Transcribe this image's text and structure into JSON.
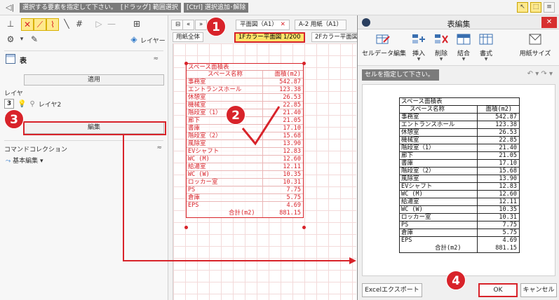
{
  "topbar": {
    "back_icon": "back-arrow-icon",
    "hints": [
      "選択する要素を指定して下さい。",
      "[ドラッグ] 範囲選択",
      "[Ctrl] 選択追加･解除"
    ]
  },
  "left_panel": {
    "layer_button": "レイヤー",
    "property_title": "表",
    "apply_button": "適用",
    "layer_label": "レイヤ",
    "layer_number": "3",
    "layer_name": "レイヤ2",
    "table_label": "表",
    "edit_button": "編集",
    "command_collection": "コマンドコレクション",
    "basic_edit": "基本編集"
  },
  "drawing": {
    "tabs": [
      "平面図（A1）",
      "A-2 用紙（A1）"
    ],
    "sub_tabs": [
      "用紙全体",
      "1Fカラー平面図 1/200",
      "2Fカラー平面図"
    ],
    "table_title": "スペース面積表",
    "header_name": "スペース名称",
    "header_area": "面積(m2)",
    "rows": [
      {
        "name": "事務室",
        "area": "542.87"
      },
      {
        "name": "エントランスホール",
        "area": "123.38"
      },
      {
        "name": "休憩室",
        "area": "26.53"
      },
      {
        "name": "機械室",
        "area": "22.85"
      },
      {
        "name": "階段室（1）",
        "area": "21.40"
      },
      {
        "name": "廊下",
        "area": "21.05"
      },
      {
        "name": "書庫",
        "area": "17.10"
      },
      {
        "name": "階段室（2）",
        "area": "15.68"
      },
      {
        "name": "風除室",
        "area": "13.90"
      },
      {
        "name": "EVシャフト",
        "area": "12.83"
      },
      {
        "name": "WC (M)",
        "area": "12.60"
      },
      {
        "name": "給湯室",
        "area": "12.11"
      },
      {
        "name": "WC (W)",
        "area": "10.35"
      },
      {
        "name": "ロッカー室",
        "area": "10.31"
      },
      {
        "name": "PS",
        "area": "7.75"
      },
      {
        "name": "倉庫",
        "area": "5.75"
      },
      {
        "name": "EPS",
        "area": "4.69"
      }
    ],
    "total_name": "合計(m2)",
    "total_area": "881.15"
  },
  "dialog": {
    "title": "表編集",
    "ribbon": [
      {
        "label": "セルデータ編集",
        "icon": "cell-edit-icon",
        "dropdown": false
      },
      {
        "label": "挿入",
        "icon": "insert-icon",
        "dropdown": true
      },
      {
        "label": "削除",
        "icon": "delete-icon",
        "dropdown": true
      },
      {
        "label": "結合",
        "icon": "merge-icon",
        "dropdown": true
      },
      {
        "label": "書式",
        "icon": "format-icon",
        "dropdown": true
      },
      {
        "label": "用紙サイズ",
        "icon": "paper-size-icon",
        "dropdown": false
      }
    ],
    "status": "セルを指定して下さい。",
    "table_title": "スペース面積表",
    "header_name": "スペース名称",
    "header_area": "面積(m2)",
    "rows": [
      {
        "name": "事務室",
        "area": "542.87"
      },
      {
        "name": "エントランスホール",
        "area": "123.38"
      },
      {
        "name": "休憩室",
        "area": "26.53"
      },
      {
        "name": "機械室",
        "area": "22.85"
      },
      {
        "name": "階段室（1）",
        "area": "21.40"
      },
      {
        "name": "廊下",
        "area": "21.05"
      },
      {
        "name": "書庫",
        "area": "17.10"
      },
      {
        "name": "階段室（2）",
        "area": "15.68"
      },
      {
        "name": "風除室",
        "area": "13.90"
      },
      {
        "name": "EVシャフト",
        "area": "12.83"
      },
      {
        "name": "WC (M)",
        "area": "12.60"
      },
      {
        "name": "給湯室",
        "area": "12.11"
      },
      {
        "name": "WC (W)",
        "area": "10.35"
      },
      {
        "name": "ロッカー室",
        "area": "10.31"
      },
      {
        "name": "PS",
        "area": "7.75"
      },
      {
        "name": "倉庫",
        "area": "5.75"
      },
      {
        "name": "EPS",
        "area": "4.69"
      }
    ],
    "total_name": "合計(m2)",
    "total_area": "881.15",
    "excel_button": "Excelエクスポート",
    "ok_button": "OK",
    "cancel_button": "キャンセル"
  },
  "annotations": {
    "steps": [
      "1",
      "2",
      "3",
      "4"
    ],
    "accent_color": "#d8232a"
  }
}
